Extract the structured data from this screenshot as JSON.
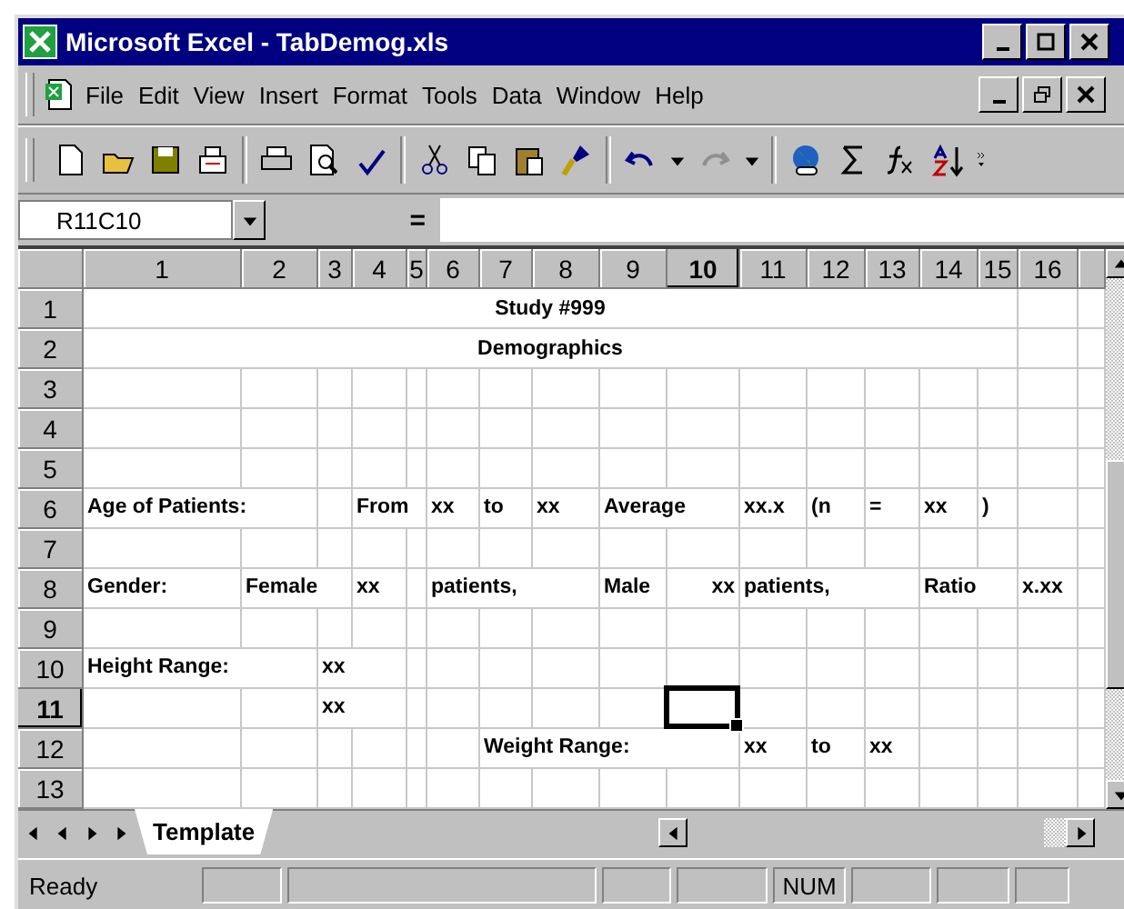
{
  "window": {
    "title": "Microsoft Excel - TabDemog.xls"
  },
  "menu": [
    "File",
    "Edit",
    "View",
    "Insert",
    "Format",
    "Tools",
    "Data",
    "Window",
    "Help"
  ],
  "formula_bar": {
    "name_box": "R11C10",
    "equals": "="
  },
  "columns": [
    {
      "label": "1",
      "selected": false
    },
    {
      "label": "2",
      "selected": false
    },
    {
      "label": "3",
      "selected": false
    },
    {
      "label": "4",
      "selected": false
    },
    {
      "label": "5",
      "selected": false
    },
    {
      "label": "6",
      "selected": false
    },
    {
      "label": "7",
      "selected": false
    },
    {
      "label": "8",
      "selected": false
    },
    {
      "label": "9",
      "selected": false
    },
    {
      "label": "10",
      "selected": true
    },
    {
      "label": "11",
      "selected": false
    },
    {
      "label": "12",
      "selected": false
    },
    {
      "label": "13",
      "selected": false
    },
    {
      "label": "14",
      "selected": false
    },
    {
      "label": "15",
      "selected": false
    },
    {
      "label": "16",
      "selected": false
    }
  ],
  "rows": [
    {
      "header": "1",
      "selected": false,
      "title": "Study #999"
    },
    {
      "header": "2",
      "selected": false,
      "title": "Demographics"
    },
    {
      "header": "3",
      "selected": false,
      "cells": [
        null,
        null,
        null,
        null,
        null,
        null,
        null,
        null,
        null,
        null,
        null,
        null,
        null,
        null,
        null,
        null
      ]
    },
    {
      "header": "4",
      "selected": false,
      "cells": [
        null,
        null,
        null,
        null,
        null,
        null,
        null,
        null,
        null,
        null,
        null,
        null,
        null,
        null,
        null,
        null
      ]
    },
    {
      "header": "5",
      "selected": false,
      "cells": [
        null,
        null,
        null,
        null,
        null,
        null,
        null,
        null,
        null,
        null,
        null,
        null,
        null,
        null,
        null,
        null
      ]
    },
    {
      "header": "6",
      "selected": false,
      "cells": [
        {
          "text": "Age of Patients:",
          "right_aligned": false
        },
        null,
        null,
        {
          "text": "From",
          "right_aligned": false
        },
        null,
        {
          "text": "xx",
          "right_aligned": false
        },
        {
          "text": "to",
          "right_aligned": false
        },
        {
          "text": "xx",
          "right_aligned": false
        },
        {
          "text": "Average",
          "right_aligned": false
        },
        null,
        {
          "text": "xx.x",
          "right_aligned": false
        },
        {
          "text": "(n",
          "right_aligned": false
        },
        {
          "text": "=",
          "right_aligned": false
        },
        {
          "text": "xx",
          "right_aligned": false
        },
        {
          "text": ")",
          "right_aligned": false
        },
        null
      ]
    },
    {
      "header": "7",
      "selected": false,
      "cells": [
        null,
        null,
        null,
        null,
        null,
        null,
        null,
        null,
        null,
        null,
        null,
        null,
        null,
        null,
        null,
        null
      ]
    },
    {
      "header": "8",
      "selected": false,
      "cells": [
        {
          "text": "Gender:",
          "right_aligned": false
        },
        {
          "text": "Female",
          "right_aligned": false
        },
        null,
        {
          "text": "xx",
          "right_aligned": false
        },
        null,
        {
          "text": "patients,",
          "right_aligned": false
        },
        null,
        null,
        {
          "text": "Male",
          "right_aligned": false
        },
        {
          "text": "xx",
          "right_aligned": true
        },
        {
          "text": "patients,",
          "right_aligned": false
        },
        null,
        null,
        {
          "text": "Ratio",
          "right_aligned": false
        },
        null,
        {
          "text": "x.xx",
          "right_aligned": false
        }
      ]
    },
    {
      "header": "9",
      "selected": false,
      "cells": [
        null,
        null,
        null,
        null,
        null,
        null,
        null,
        null,
        null,
        null,
        null,
        null,
        null,
        null,
        null,
        null
      ]
    },
    {
      "header": "10",
      "selected": false,
      "cells": [
        {
          "text": "Height Range:",
          "right_aligned": false
        },
        null,
        {
          "text": "xx",
          "right_aligned": false
        },
        null,
        null,
        null,
        null,
        null,
        null,
        null,
        null,
        null,
        null,
        null,
        null,
        null
      ]
    },
    {
      "header": "11",
      "selected": true,
      "cells": [
        null,
        null,
        {
          "text": "xx",
          "right_aligned": false
        },
        null,
        null,
        null,
        null,
        null,
        null,
        null,
        null,
        null,
        null,
        null,
        null,
        null
      ]
    },
    {
      "header": "12",
      "selected": false,
      "cells": [
        null,
        null,
        null,
        null,
        null,
        null,
        {
          "text": "Weight Range:",
          "right_aligned": false
        },
        null,
        null,
        null,
        {
          "text": "xx",
          "right_aligned": false
        },
        {
          "text": "to",
          "right_aligned": false
        },
        {
          "text": "xx",
          "right_aligned": false
        },
        null,
        null,
        null
      ]
    },
    {
      "header": "13",
      "selected": false,
      "cells": [
        null,
        null,
        null,
        null,
        null,
        null,
        null,
        null,
        null,
        null,
        null,
        null,
        null,
        null,
        null,
        null
      ]
    }
  ],
  "sheet_tabs": [
    {
      "label": "Template",
      "selected": true
    }
  ],
  "status_bar": {
    "message": "Ready",
    "panels": [
      {
        "kind": "empty"
      },
      {
        "kind": "empty"
      },
      {
        "kind": "empty"
      },
      {
        "kind": "empty"
      },
      {
        "kind": "indicator",
        "text": "NUM"
      },
      {
        "kind": "empty"
      },
      {
        "kind": "empty"
      },
      {
        "kind": "empty"
      }
    ]
  }
}
